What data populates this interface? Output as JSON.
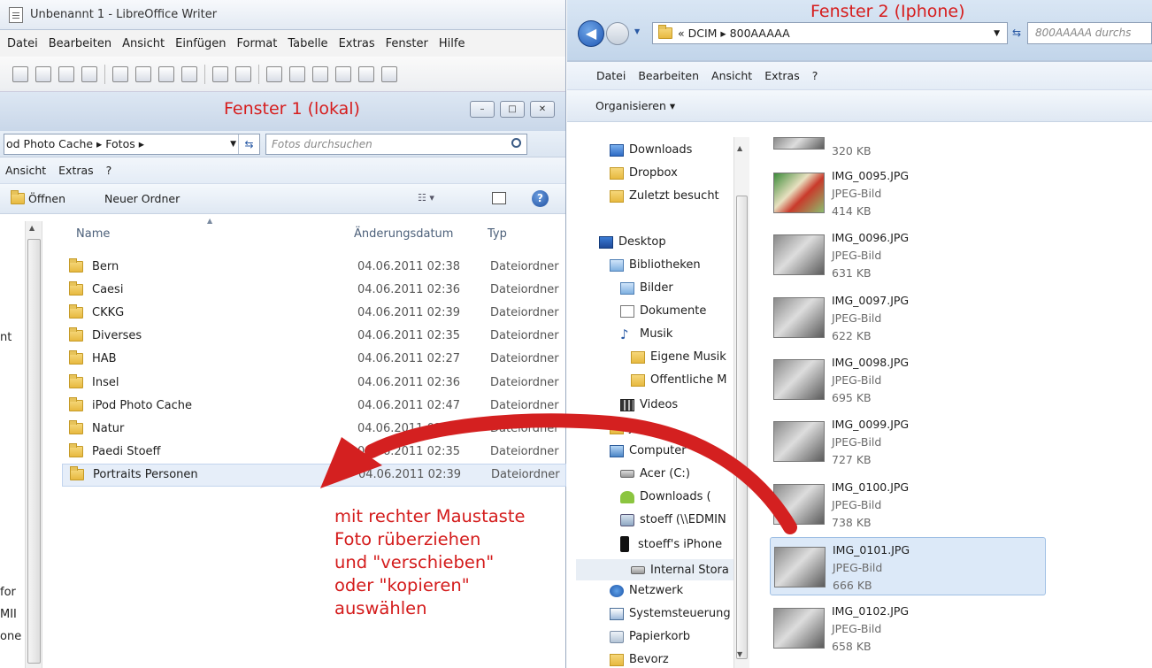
{
  "left": {
    "writer_title": "Unbenannt 1 - LibreOffice Writer",
    "writer_menu": [
      "Datei",
      "Bearbeiten",
      "Ansicht",
      "Einfügen",
      "Format",
      "Tabelle",
      "Extras",
      "Fenster",
      "Hilfe"
    ],
    "annotation_title": "Fenster 1 (lokal)",
    "window_buttons": [
      "–",
      "□",
      "✕"
    ],
    "path": "od Photo Cache  ▸  Fotos  ▸",
    "search_placeholder": "Fotos durchsuchen",
    "menu": [
      "Ansicht",
      "Extras",
      "?"
    ],
    "cmd_open": "Öffnen",
    "cmd_new_folder": "Neuer Ordner",
    "columns": {
      "name": "Name",
      "date": "Änderungsdatum",
      "type": "Typ"
    },
    "rows": [
      {
        "name": "Bern",
        "date": "04.06.2011 02:38",
        "type": "Dateiordner"
      },
      {
        "name": "Caesi",
        "date": "04.06.2011 02:36",
        "type": "Dateiordner"
      },
      {
        "name": "CKKG",
        "date": "04.06.2011 02:39",
        "type": "Dateiordner"
      },
      {
        "name": "Diverses",
        "date": "04.06.2011 02:35",
        "type": "Dateiordner"
      },
      {
        "name": "HAB",
        "date": "04.06.2011 02:27",
        "type": "Dateiordner"
      },
      {
        "name": "Insel",
        "date": "04.06.2011 02:36",
        "type": "Dateiordner"
      },
      {
        "name": "iPod Photo Cache",
        "date": "04.06.2011 02:47",
        "type": "Dateiordner"
      },
      {
        "name": "Natur",
        "date": "04.06.2011 02:40",
        "type": "Dateiordner"
      },
      {
        "name": "Paedi Stoeff",
        "date": "04.06.2011 02:35",
        "type": "Dateiordner"
      },
      {
        "name": "Portraits Personen",
        "date": "04.06.2011 02:39",
        "type": "Dateiordner"
      }
    ],
    "partial_texts": [
      "nt",
      "for",
      "MII",
      "one"
    ]
  },
  "right": {
    "annotation_title": "Fenster 2 (Iphone)",
    "path": "«  DCIM  ▸  800AAAAA",
    "search_placeholder": "800AAAAA durchs",
    "menu": [
      "Datei",
      "Bearbeiten",
      "Ansicht",
      "Extras",
      "?"
    ],
    "organize": "Organisieren  ▾",
    "nav": [
      {
        "label": "Downloads",
        "icon": "downloads-folder-icon"
      },
      {
        "label": "Dropbox",
        "icon": "folder-icon"
      },
      {
        "label": "Zuletzt besucht",
        "icon": "recent-places-icon"
      },
      {
        "label": "Desktop",
        "icon": "desktop-icon"
      },
      {
        "label": "Bibliotheken",
        "icon": "libraries-icon"
      },
      {
        "label": "Bilder",
        "icon": "pictures-library-icon"
      },
      {
        "label": "Dokumente",
        "icon": "documents-icon"
      },
      {
        "label": "Musik",
        "icon": "music-icon"
      },
      {
        "label": "Eigene Musik",
        "icon": "folder-icon"
      },
      {
        "label": "Öffentliche M",
        "icon": "folder-icon"
      },
      {
        "label": "Videos",
        "icon": "videos-icon"
      },
      {
        "label": "jac",
        "icon": "folder-icon"
      },
      {
        "label": "Computer",
        "icon": "computer-icon"
      },
      {
        "label": "Acer (C:)",
        "icon": "drive-icon"
      },
      {
        "label": "Downloads (",
        "icon": "android-icon"
      },
      {
        "label": "stoeff (\\\\EDMIN",
        "icon": "network-drive-icon"
      },
      {
        "label": "stoeff's iPhone",
        "icon": "iphone-icon"
      },
      {
        "label": "Internal Stora",
        "icon": "storage-icon"
      },
      {
        "label": "Netzwerk",
        "icon": "network-icon"
      },
      {
        "label": "Systemsteuerung",
        "icon": "control-panel-icon"
      },
      {
        "label": "Papierkorb",
        "icon": "recycle-bin-icon"
      },
      {
        "label": "Bevorz",
        "icon": "folder-icon"
      }
    ],
    "files": [
      {
        "name": "",
        "type": "",
        "size": "320 KB"
      },
      {
        "name": "IMG_0095.JPG",
        "type": "JPEG-Bild",
        "size": "414 KB"
      },
      {
        "name": "IMG_0096.JPG",
        "type": "JPEG-Bild",
        "size": "631 KB"
      },
      {
        "name": "IMG_0097.JPG",
        "type": "JPEG-Bild",
        "size": "622 KB"
      },
      {
        "name": "IMG_0098.JPG",
        "type": "JPEG-Bild",
        "size": "695 KB"
      },
      {
        "name": "IMG_0099.JPG",
        "type": "JPEG-Bild",
        "size": "727 KB"
      },
      {
        "name": "IMG_0100.JPG",
        "type": "JPEG-Bild",
        "size": "738 KB"
      },
      {
        "name": "IMG_0101.JPG",
        "type": "JPEG-Bild",
        "size": "666 KB"
      },
      {
        "name": "IMG_0102.JPG",
        "type": "JPEG-Bild",
        "size": "658 KB"
      }
    ],
    "selected_file": "IMG_0101.JPG"
  },
  "instruction": [
    "mit rechter Maustaste",
    "Foto rüberziehen",
    "und \"verschieben\"",
    "oder \"kopieren\"",
    "auswählen"
  ],
  "colors": {
    "annotation": "#d61d1d",
    "selection": "#dce9f8",
    "arrow": "#d42020"
  }
}
